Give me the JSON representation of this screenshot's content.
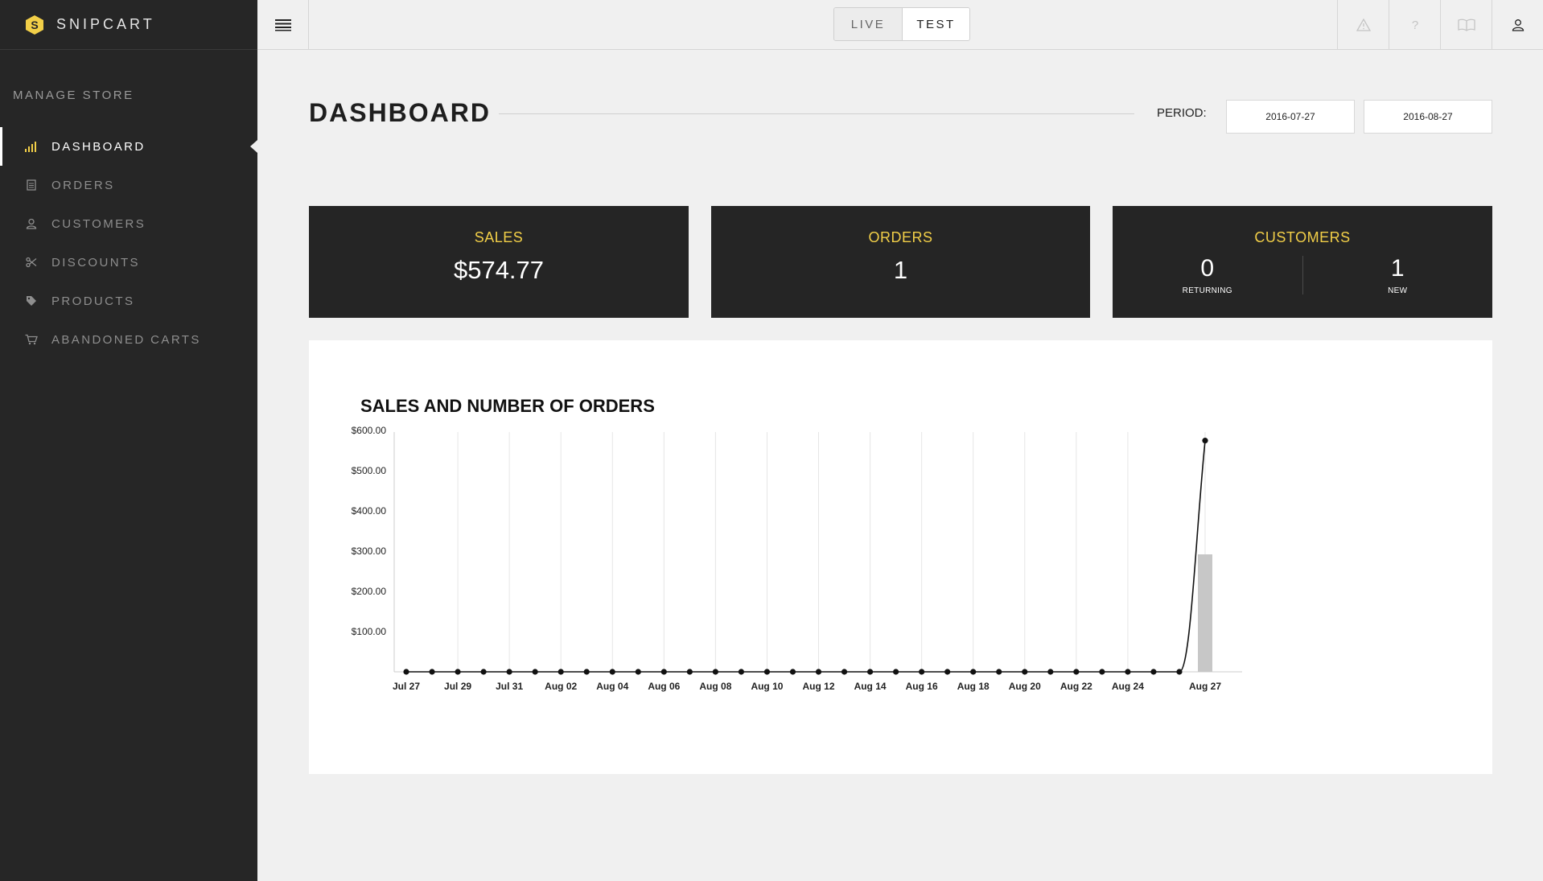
{
  "brand": {
    "name": "SNIPCART"
  },
  "sidebar": {
    "section_title": "MANAGE STORE",
    "items": [
      {
        "label": "DASHBOARD",
        "icon": "bar-chart-icon",
        "active": true
      },
      {
        "label": "ORDERS",
        "icon": "document-icon"
      },
      {
        "label": "CUSTOMERS",
        "icon": "user-icon"
      },
      {
        "label": "DISCOUNTS",
        "icon": "scissors-icon"
      },
      {
        "label": "PRODUCTS",
        "icon": "tag-icon"
      },
      {
        "label": "ABANDONED CARTS",
        "icon": "cart-icon"
      }
    ]
  },
  "topbar": {
    "env_live": "LIVE",
    "env_test": "TEST",
    "selected_env": "TEST",
    "icons": [
      "warning-icon",
      "help-icon",
      "book-icon",
      "user-icon"
    ]
  },
  "page": {
    "title": "DASHBOARD",
    "period_label": "PERIOD:",
    "date_from": "2016-07-27",
    "date_to": "2016-08-27"
  },
  "stats": {
    "sales": {
      "title": "SALES",
      "value": "$574.77"
    },
    "orders": {
      "title": "ORDERS",
      "value": "1"
    },
    "customers": {
      "title": "CUSTOMERS",
      "returning_value": "0",
      "returning_label": "RETURNING",
      "new_value": "1",
      "new_label": "NEW"
    }
  },
  "colors": {
    "accent": "#f2cf48",
    "sidebar_bg": "#262626",
    "card_bg": "#252525"
  },
  "chart_data": {
    "type": "line",
    "title": "SALES AND NUMBER OF ORDERS",
    "x": [
      "Jul 27",
      "Jul 28",
      "Jul 29",
      "Jul 30",
      "Jul 31",
      "Aug 01",
      "Aug 02",
      "Aug 03",
      "Aug 04",
      "Aug 05",
      "Aug 06",
      "Aug 07",
      "Aug 08",
      "Aug 09",
      "Aug 10",
      "Aug 11",
      "Aug 12",
      "Aug 13",
      "Aug 14",
      "Aug 15",
      "Aug 16",
      "Aug 17",
      "Aug 18",
      "Aug 19",
      "Aug 20",
      "Aug 21",
      "Aug 22",
      "Aug 23",
      "Aug 24",
      "Aug 25",
      "Aug 26",
      "Aug 27"
    ],
    "x_tick_labels": [
      "Jul 27",
      "Jul 29",
      "Jul 31",
      "Aug 02",
      "Aug 04",
      "Aug 06",
      "Aug 08",
      "Aug 10",
      "Aug 12",
      "Aug 14",
      "Aug 16",
      "Aug 18",
      "Aug 20",
      "Aug 22",
      "Aug 24",
      "Aug 27"
    ],
    "y_ticks": [
      "$100.00",
      "$200.00",
      "$300.00",
      "$400.00",
      "$500.00",
      "$600.00"
    ],
    "ylim": [
      0,
      600
    ],
    "series": [
      {
        "type": "line",
        "values": [
          0,
          0,
          0,
          0,
          0,
          0,
          0,
          0,
          0,
          0,
          0,
          0,
          0,
          0,
          0,
          0,
          0,
          0,
          0,
          0,
          0,
          0,
          0,
          0,
          0,
          0,
          0,
          0,
          0,
          0,
          0,
          574.77
        ]
      },
      {
        "type": "bar",
        "values": [
          0,
          0,
          0,
          0,
          0,
          0,
          0,
          0,
          0,
          0,
          0,
          0,
          0,
          0,
          0,
          0,
          0,
          0,
          0,
          0,
          0,
          0,
          0,
          0,
          0,
          0,
          0,
          0,
          0,
          0,
          0,
          1
        ]
      }
    ],
    "bar_ylim": [
      0,
      2
    ],
    "grid": true
  }
}
